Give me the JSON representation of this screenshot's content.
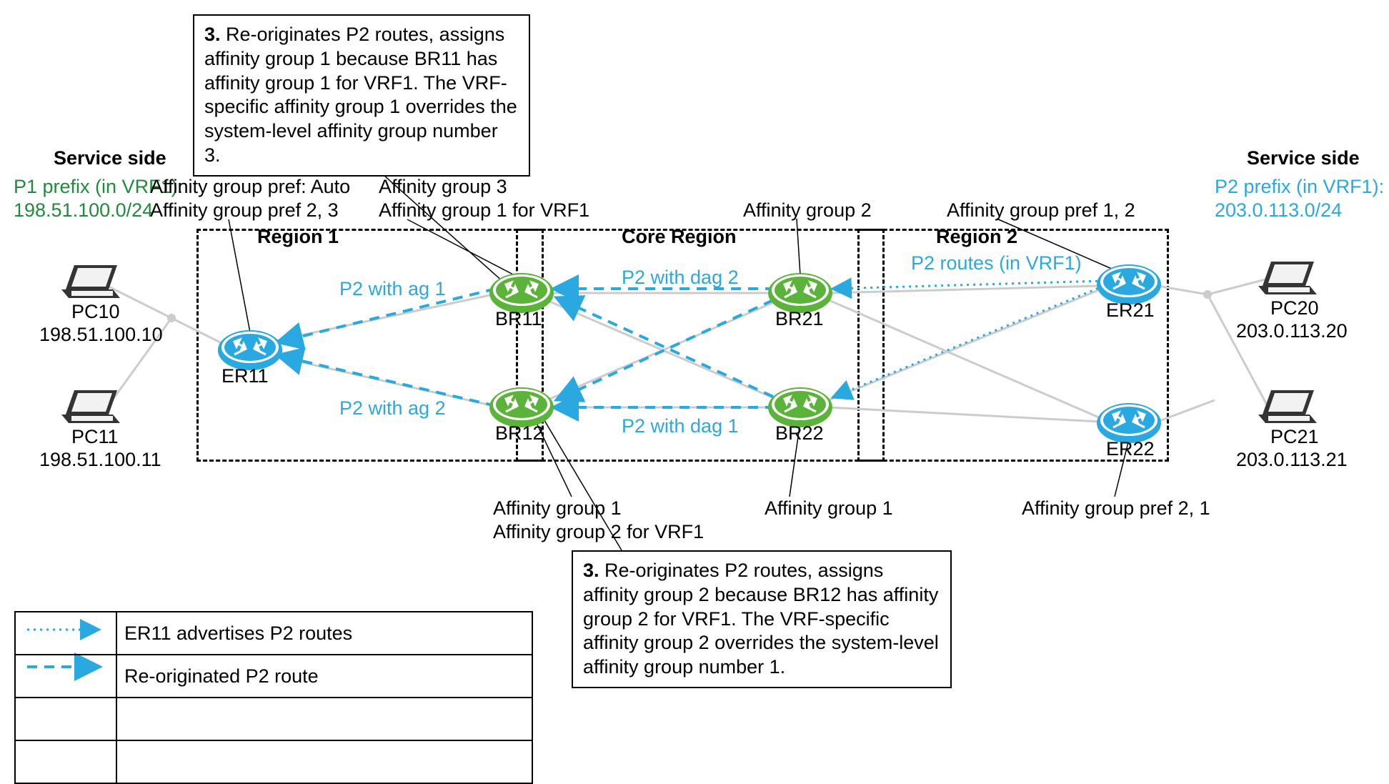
{
  "headings": {
    "service_left": "Service side",
    "service_right": "Service side",
    "region1": "Region 1",
    "core": "Core Region",
    "region2": "Region 2"
  },
  "prefixes": {
    "p1_line1": "P1 prefix (in VRF1):",
    "p1_line2": "198.51.100.0/24",
    "p2_line1": "P2 prefix (in VRF1):",
    "p2_line2": "203.0.113.0/24"
  },
  "devices": {
    "pc10_name": "PC10",
    "pc10_ip": "198.51.100.10",
    "pc11_name": "PC11",
    "pc11_ip": "198.51.100.11",
    "pc20_name": "PC20",
    "pc20_ip": "203.0.113.20",
    "pc21_name": "PC21",
    "pc21_ip": "203.0.113.21",
    "er11": "ER11",
    "br11": "BR11",
    "br12": "BR12",
    "br21": "BR21",
    "br22": "BR22",
    "er21": "ER21",
    "er22": "ER22"
  },
  "affinity": {
    "er11_line1": "Affinity group pref: Auto",
    "er11_line2": "Affinity group pref 2, 3",
    "br11_line1": "Affinity group  3",
    "br11_line2": "Affinity group 1 for VRF1",
    "br12_line1": "Affinity group 1",
    "br12_line2": "Affinity group 2 for VRF1",
    "br21": "Affinity group 2",
    "br22": "Affinity group 1",
    "er21": "Affinity group pref 1, 2",
    "er22": "Affinity group pref 2, 1"
  },
  "routes": {
    "p2_ag1": "P2 with ag 1",
    "p2_ag2": "P2 with ag 2",
    "p2_dag1": "P2 with dag 1",
    "p2_dag2": "P2 with dag 2",
    "p2_routes_vrf1": "P2 routes (in VRF1)"
  },
  "callouts": {
    "top_lead": "3.",
    "top_rest": " Re-originates P2 routes, assigns affinity group 1 because BR11 has affinity group 1 for VRF1. The VRF-specific affinity group 1 overrides the system-level affinity group number 3.",
    "bottom_lead": "3.",
    "bottom_rest": " Re-originates P2 routes, assigns affinity group 2 because BR12 has affinity group 2 for VRF1. The VRF-specific affinity group 2 overrides the system-level affinity group number 1."
  },
  "legend": {
    "row1": "ER11 advertises P2 routes",
    "row2": "Re-originated P2 route"
  }
}
